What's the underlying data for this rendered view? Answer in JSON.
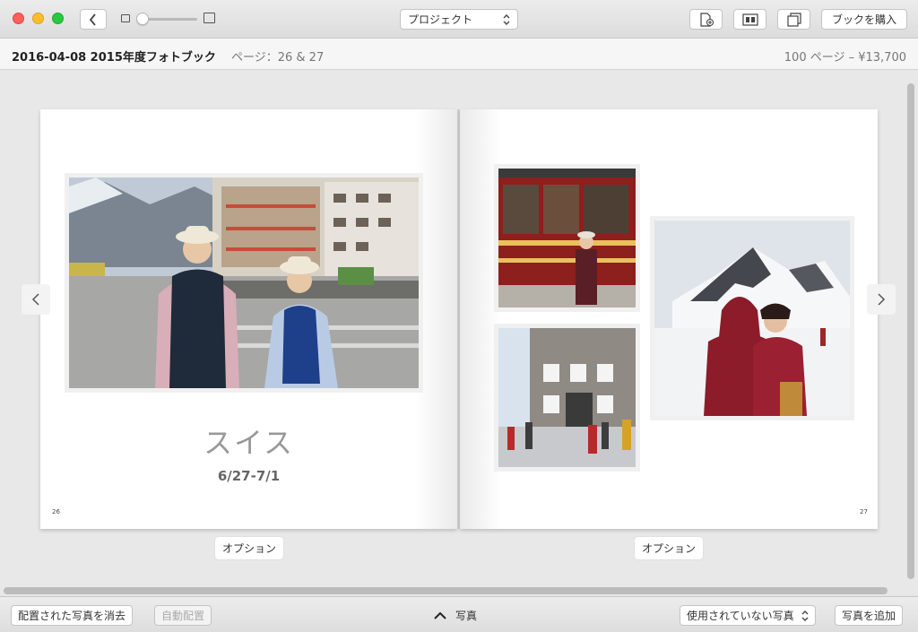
{
  "toolbar": {
    "project_label": "プロジェクト",
    "buy_label": "ブックを購入"
  },
  "info": {
    "book_title": "2016-04-08 2015年度フォトブック",
    "page_info": "ページ：26 & 27",
    "price_info": "100 ページ – ¥13,700"
  },
  "left_page": {
    "heading": "スイス",
    "dates": "6/27-7/1",
    "page_number": "26",
    "options_label": "オプション"
  },
  "right_page": {
    "page_number": "27",
    "options_label": "オプション"
  },
  "bottom": {
    "clear_label": "配置された写真を消去",
    "autoflow_label": "自動配置",
    "photos_label": "写真",
    "unused_label": "使用されていない写真",
    "add_label": "写真を追加"
  },
  "icons": {
    "back": "chevron-left-icon",
    "add_page": "add-page-icon",
    "layout": "layout-icon",
    "page_view": "page-view-icon"
  },
  "colors": {
    "close": "#fe5f57",
    "minimize": "#febc2e",
    "zoom": "#28c840"
  }
}
